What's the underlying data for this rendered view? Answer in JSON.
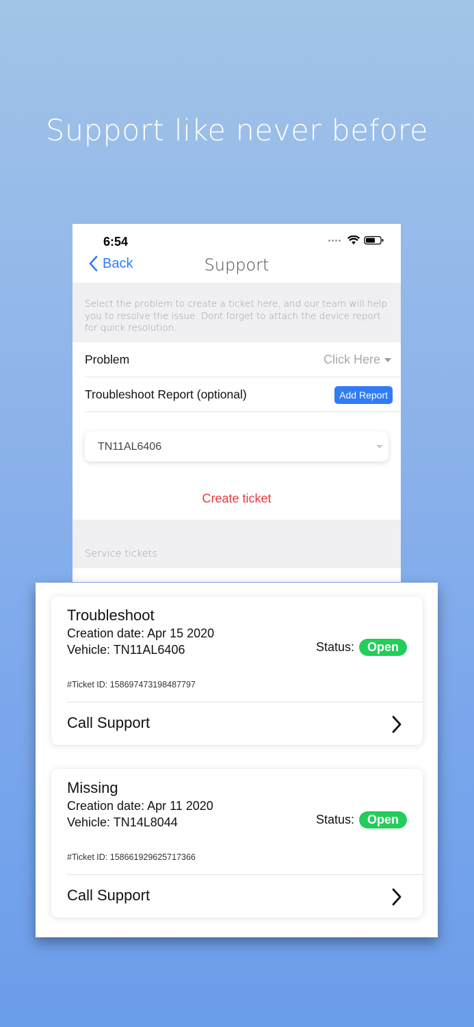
{
  "headline": "Support like never before",
  "status_bar": {
    "time": "6:54"
  },
  "nav": {
    "back_label": "Back",
    "title": "Support"
  },
  "info_text": "Select the problem to create a ticket here, and our team will help you to resolve the issue. Dont forget to attach the device report for quick resolution.",
  "form": {
    "problem_label": "Problem",
    "problem_placeholder": "Click Here",
    "report_label": "Troubleshoot Report (optional)",
    "add_report_button": "Add Report",
    "vehicle_selected": "TN11AL6406",
    "create_ticket": "Create ticket"
  },
  "section_header": "Service tickets",
  "tickets": [
    {
      "type": "Troubleshoot",
      "creation_date": "Creation date: Apr 15 2020",
      "vehicle": "Vehicle: TN11AL6406",
      "status_label": "Status:",
      "status": "Open",
      "ticket_id": "#Ticket ID: 158697473198487797",
      "call_support": "Call Support"
    },
    {
      "type": "Missing",
      "creation_date": "Creation date: Apr 11 2020",
      "vehicle": "Vehicle: TN14L8044",
      "status_label": "Status:",
      "status": "Open",
      "ticket_id": "#Ticket ID: 158661929625717366",
      "call_support": "Call Support"
    }
  ],
  "colors": {
    "accent": "#2f7cf6",
    "danger": "#e8383d",
    "status_open": "#22cd5b"
  }
}
